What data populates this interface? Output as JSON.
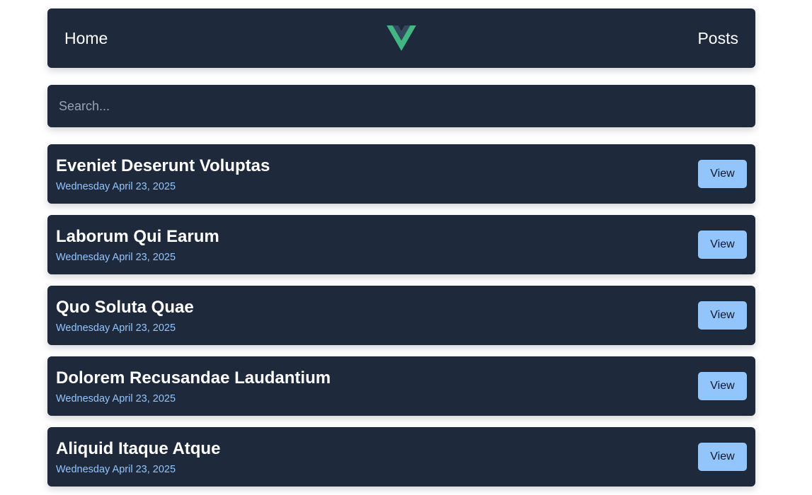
{
  "nav": {
    "home_label": "Home",
    "posts_label": "Posts",
    "logo_icon": "vue-logo-icon",
    "logo_colors": {
      "outer": "#41b883",
      "inner": "#35495e"
    }
  },
  "search": {
    "placeholder": "Search...",
    "value": ""
  },
  "posts": [
    {
      "title": "Eveniet Deserunt Voluptas",
      "date": "Wednesday April 23, 2025",
      "button_label": "View"
    },
    {
      "title": "Laborum Qui Earum",
      "date": "Wednesday April 23, 2025",
      "button_label": "View"
    },
    {
      "title": "Quo Soluta Quae",
      "date": "Wednesday April 23, 2025",
      "button_label": "View"
    },
    {
      "title": "Dolorem Recusandae Laudantium",
      "date": "Wednesday April 23, 2025",
      "button_label": "View"
    },
    {
      "title": "Aliquid Itaque Atque",
      "date": "Wednesday April 23, 2025",
      "button_label": "View"
    }
  ],
  "colors": {
    "card_bg": "#1e293b",
    "accent": "#93c5fd",
    "page_bg": "#ffffff"
  }
}
